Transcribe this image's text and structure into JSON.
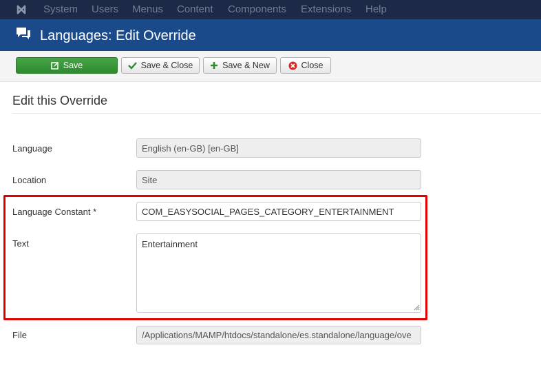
{
  "nav": {
    "items": [
      "System",
      "Users",
      "Menus",
      "Content",
      "Components",
      "Extensions",
      "Help"
    ]
  },
  "header": {
    "title": "Languages: Edit Override"
  },
  "toolbar": {
    "save": "Save",
    "save_close": "Save & Close",
    "save_new": "Save & New",
    "close": "Close"
  },
  "section": {
    "title": "Edit this Override"
  },
  "form": {
    "language": {
      "label": "Language",
      "value": "English (en-GB) [en-GB]"
    },
    "location": {
      "label": "Location",
      "value": "Site"
    },
    "constant": {
      "label": "Language Constant *",
      "value": "COM_EASYSOCIAL_PAGES_CATEGORY_ENTERTAINMENT"
    },
    "text": {
      "label": "Text",
      "value": "Entertainment"
    },
    "file": {
      "label": "File",
      "value": "/Applications/MAMP/htdocs/standalone/es.standalone/language/ove"
    }
  },
  "colors": {
    "nav_bg": "#1c2a48",
    "header_bg": "#1b4a8a",
    "save_green": "#46a546",
    "highlight": "#e00000"
  }
}
